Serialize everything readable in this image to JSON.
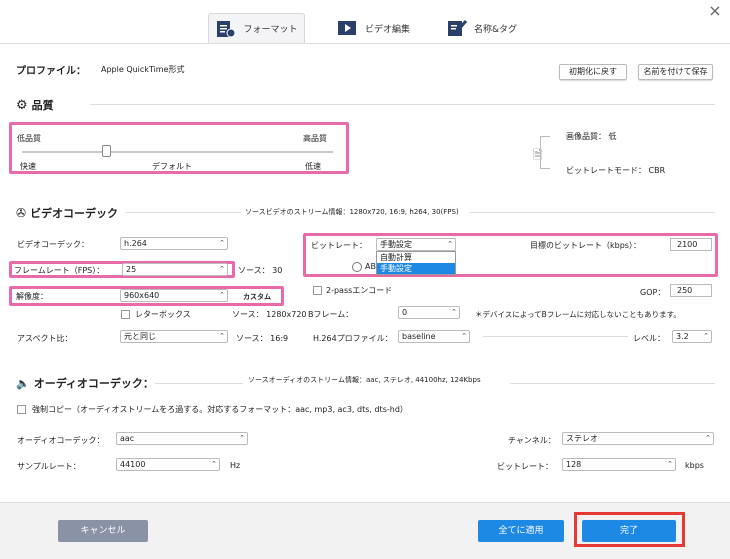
{
  "tabs": [
    {
      "label": "フォーマット"
    },
    {
      "label": "ビデオ編集"
    },
    {
      "label": "名称&タグ"
    }
  ],
  "profile": {
    "label": "プロファイル：",
    "value": "Apple QuickTime形式",
    "reset": "初期化に戻す",
    "save_as": "名前を付けて保存"
  },
  "quality": {
    "title": "品質",
    "low": "低品質",
    "high": "高品質",
    "fast": "快速",
    "default": "デフォルト",
    "slow": "低速",
    "slider_value": 0.27,
    "image_quality": "画像品質：  低",
    "bitrate_mode": "ビットレートモード：  CBR"
  },
  "video": {
    "title": "ビデオコーデック",
    "source_info": "ソースビデオのストリーム情報：1280x720, 16:9, h264, 30(FPS)",
    "codec_label": "ビデオコーデック：",
    "codec_value": "h.264",
    "fps_label": "フレームレート（FPS）：",
    "fps_value": "25",
    "fps_source": "ソース：  30",
    "res_label": "解像度：",
    "res_value": "960x640",
    "custom": "カスタム",
    "letterbox": "レターボックス",
    "res_source": "ソース：  1280x720",
    "aspect_label": "アスペクト比：",
    "aspect_value": "元と同じ",
    "aspect_source": "ソース：  16:9",
    "bitrate_label": "ビットレート：",
    "bitrate_mode_value": "手動設定",
    "options": [
      "自動計算",
      "手動設定"
    ],
    "ab_partial": "AB",
    "target_label": "目標のビットレート（kbps）：",
    "target_value": "2100",
    "twopass": "2-passエンコード",
    "gop_label": "GOP：",
    "gop_value": "250",
    "bframe_label": "Bフレーム：",
    "bframe_value": "0",
    "bframe_note": "＊デバイスによってBフレームに対応しないこともあります。",
    "profile_label": "H.264プロファイル：",
    "profile_value": "baseline",
    "level_label": "レベル：",
    "level_value": "3.2"
  },
  "audio": {
    "title": "オーディオコーデック：",
    "source_info": "ソースオーディオのストリーム情報：aac, ステレオ, 44100hz, 124Kbps",
    "copy": "強制コピー（オーディオストリームをろ過する。対応するフォーマット：aac, mp3, ac3, dts, dts-hd）",
    "codec_label": "オーディオコーデック：",
    "codec_value": "aac",
    "channel_label": "チャンネル：",
    "channel_value": "ステレオ",
    "sample_label": "サンプルレート：",
    "sample_value": "44100",
    "hz": "Hz",
    "bitrate_label": "ビットレート：",
    "bitrate_value": "128",
    "kbps": "kbps"
  },
  "footer": {
    "cancel": "キャンセル",
    "apply_all": "全てに適用",
    "done": "完了"
  },
  "colors": {
    "accent": "#1e88e5",
    "highlight": "#e86aa8",
    "done_border": "#e53935",
    "cancel": "#8a93a6"
  }
}
